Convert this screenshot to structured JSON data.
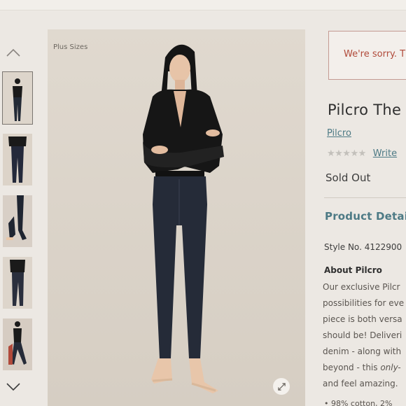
{
  "thumbnail_rail": {
    "scroll_up_icon": "chevron-up-icon",
    "scroll_down_icon": "chevron-down-icon",
    "thumbnails": [
      "thumb-1",
      "thumb-2",
      "thumb-3",
      "thumb-4",
      "thumb-5"
    ]
  },
  "main_image": {
    "label": "Plus Sizes",
    "zoom_icon": "expand-icon"
  },
  "alert": {
    "text": "We're sorry. T"
  },
  "product": {
    "title": "Pilcro The",
    "brand": "Pilcro",
    "stars": "★★★★★",
    "write_review": "Write",
    "status": "Sold Out"
  },
  "details": {
    "heading": "Product Detail",
    "style_number": "Style No. 4122900",
    "about_heading": "About Pilcro",
    "about_lines": [
      [
        "Our exclusive Pilcr",
        ""
      ],
      [
        "possibilities for eve",
        ""
      ],
      [
        "piece is both versa",
        ""
      ],
      [
        "should be! Deliveri",
        ""
      ],
      [
        "denim - along with",
        ""
      ],
      [
        "beyond - this ",
        "only-"
      ],
      [
        "and feel amazing.",
        ""
      ]
    ],
    "bullet": "• 98% cotton, 2%"
  },
  "colors": {
    "accent": "#4d7a85",
    "alert": "#b04a3a",
    "background": "#ece8e3"
  }
}
